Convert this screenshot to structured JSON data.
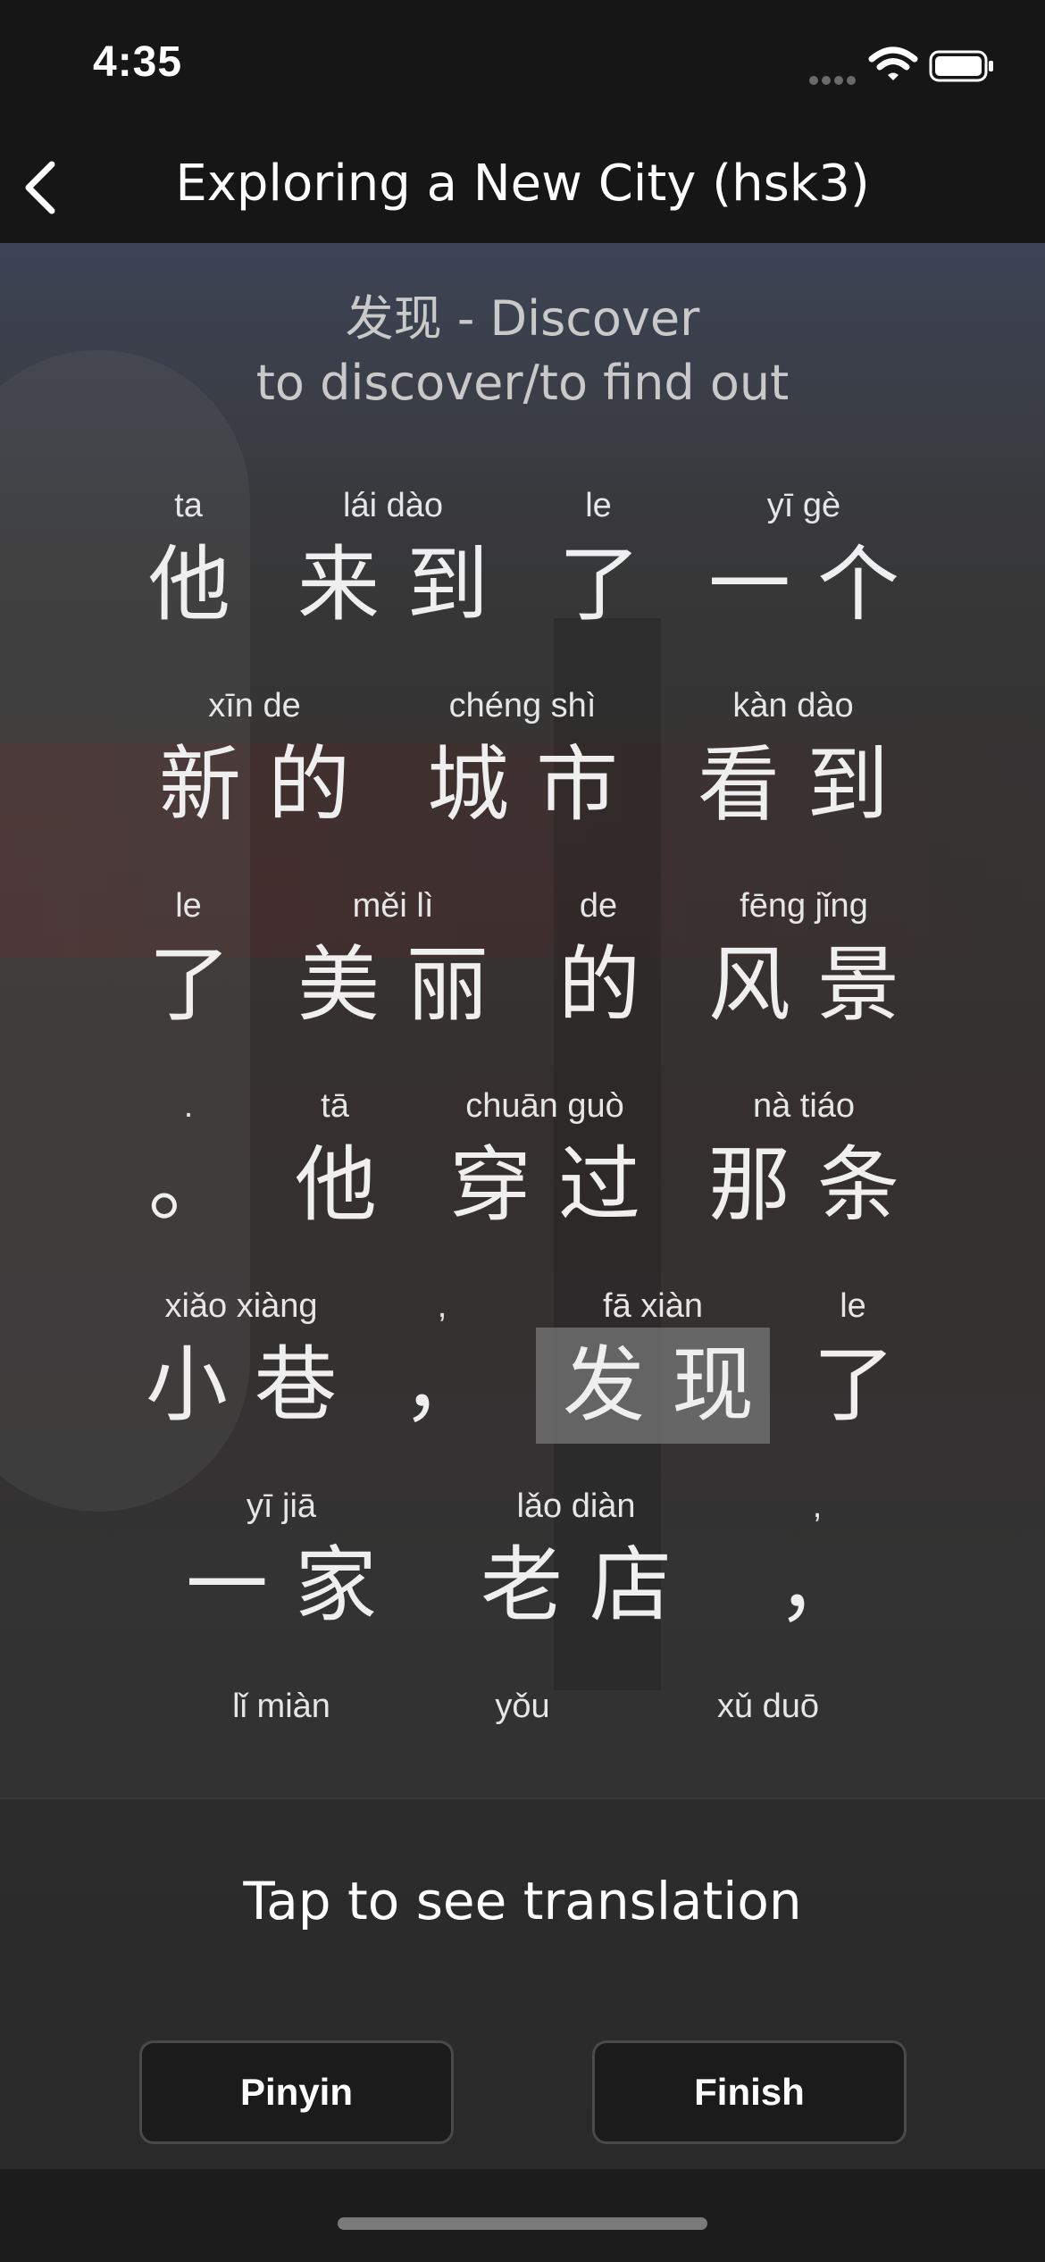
{
  "status_bar": {
    "time": "4:35",
    "signal_icon": "signal-dots-icon",
    "wifi_icon": "wifi-icon",
    "battery_icon": "battery-icon"
  },
  "nav": {
    "back_icon": "chevron-left-icon",
    "title": "Exploring a New City (hsk3)"
  },
  "word_card": {
    "headword": "发现 - Discover",
    "definition": "to discover/to find out"
  },
  "sentence": {
    "rows": [
      [
        {
          "pinyin": "ta",
          "hanzi": "他"
        },
        {
          "pinyin": "lái dào",
          "hanzi": "来到"
        },
        {
          "pinyin": "le",
          "hanzi": "了"
        },
        {
          "pinyin": "yī gè",
          "hanzi": "一个"
        }
      ],
      [
        {
          "pinyin": "xīn de",
          "hanzi": "新的"
        },
        {
          "pinyin": "chéng shì",
          "hanzi": "城市"
        },
        {
          "pinyin": "kàn dào",
          "hanzi": "看到"
        }
      ],
      [
        {
          "pinyin": "le",
          "hanzi": "了"
        },
        {
          "pinyin": "měi lì",
          "hanzi": "美丽"
        },
        {
          "pinyin": "de",
          "hanzi": "的"
        },
        {
          "pinyin": "fēng jǐng",
          "hanzi": "风景"
        }
      ],
      [
        {
          "pinyin": ".",
          "hanzi": "。"
        },
        {
          "pinyin": "tā",
          "hanzi": "他"
        },
        {
          "pinyin": "chuān guò",
          "hanzi": "穿过"
        },
        {
          "pinyin": "nà tiáo",
          "hanzi": "那条"
        }
      ],
      [
        {
          "pinyin": "xiǎo xiàng",
          "hanzi": "小巷"
        },
        {
          "pinyin": ",",
          "hanzi": "，"
        },
        {
          "pinyin": "fā xiàn",
          "hanzi": "发现",
          "highlighted": true
        },
        {
          "pinyin": "le",
          "hanzi": "了"
        }
      ],
      [
        {
          "pinyin": "yī jiā",
          "hanzi": "一家"
        },
        {
          "pinyin": "lǎo diàn",
          "hanzi": "老店"
        },
        {
          "pinyin": ",",
          "hanzi": "，"
        }
      ],
      [
        {
          "pinyin": "lǐ miàn",
          "hanzi": ""
        },
        {
          "pinyin": "yǒu",
          "hanzi": ""
        },
        {
          "pinyin": "xǔ duō",
          "hanzi": ""
        }
      ]
    ]
  },
  "bottom": {
    "prompt": "Tap to see translation",
    "pinyin_button": "Pinyin",
    "finish_button": "Finish"
  }
}
